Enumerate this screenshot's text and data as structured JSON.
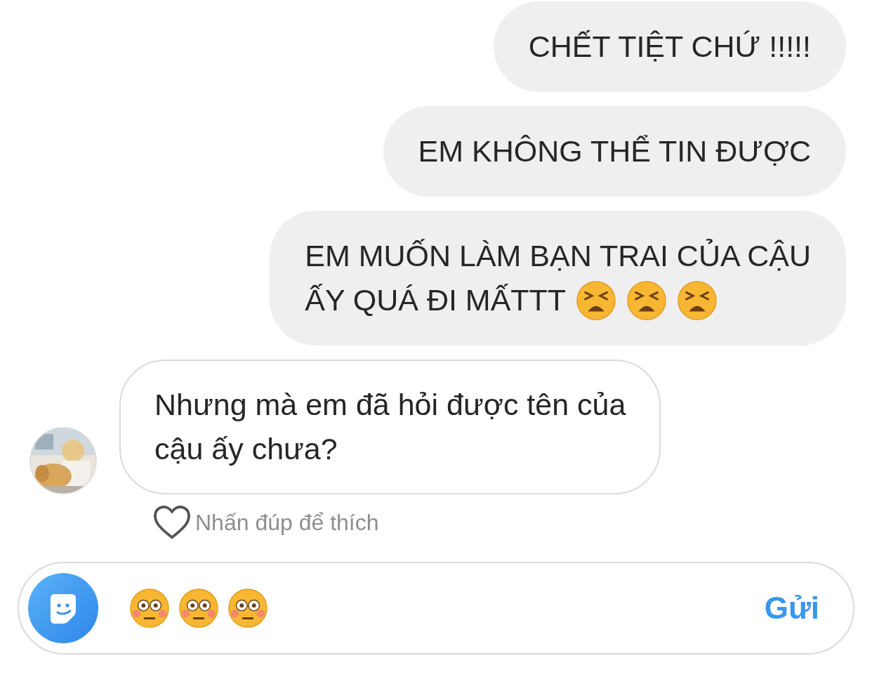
{
  "messages": [
    {
      "kind": "sent",
      "lines": [
        "CHẾT TIỆT CHỨ !!!!!"
      ]
    },
    {
      "kind": "sent",
      "lines": [
        "EM KHÔNG THỂ TIN ĐƯỢC"
      ]
    },
    {
      "kind": "sent",
      "lines": [
        "EM MUỐN LÀM BẠN TRAI CỦA CẬU",
        "ẤY QUÁ ĐI MẤTTT"
      ],
      "emojis": [
        {
          "kind": "tired"
        },
        {
          "kind": "tired"
        },
        {
          "kind": "tired"
        }
      ]
    },
    {
      "kind": "received",
      "lines": [
        "Nhưng mà em đã hỏi được tên của",
        "cậu ấy chưa?"
      ],
      "avatar": {
        "kind": "picture"
      }
    }
  ],
  "like_hint": {
    "text": "Nhấn đúp để thích",
    "liked": false
  },
  "composer": {
    "emojis": [
      {
        "kind": "flushed"
      },
      {
        "kind": "flushed"
      },
      {
        "kind": "flushed"
      }
    ],
    "send": "Gửi"
  }
}
